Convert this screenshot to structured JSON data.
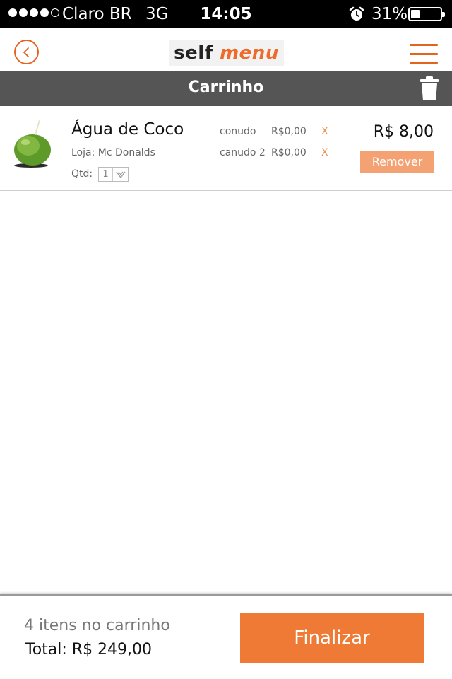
{
  "status_bar": {
    "signal_filled": 4,
    "signal_total": 5,
    "carrier": "Claro BR",
    "network": "3G",
    "time": "14:05",
    "battery": "31%",
    "battery_level": 0.31
  },
  "header": {
    "logo_self": "self",
    "logo_menu": "menu",
    "brand_color": "#e4641e"
  },
  "title_bar": {
    "title": "Carrinho",
    "color": "#555555"
  },
  "cart": {
    "items": [
      {
        "name": "Água de Coco",
        "store": "Loja: Mc Donalds",
        "qty_label": "Qtd:",
        "qty": "1",
        "price": "R$ 8,00",
        "remove_label": "Remover",
        "addons": [
          {
            "name": "conudo",
            "price": "R$0,00",
            "remove": "X"
          },
          {
            "name": "canudo 2",
            "price": "R$0,00",
            "remove": "X"
          }
        ]
      }
    ]
  },
  "footer": {
    "items_count": "4 itens no carrinho",
    "total": "Total: R$ 249,00",
    "finalize_label": "Finalizar",
    "button_color": "#ee7a35"
  }
}
